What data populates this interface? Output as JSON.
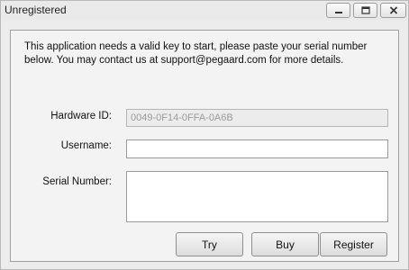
{
  "window": {
    "title": "Unregistered"
  },
  "message": "This application needs a valid key to start, please paste your serial number below. You may contact us at support@pegaard.com for more details.",
  "form": {
    "hardware_id_label": "Hardware ID:",
    "hardware_id_value": "0049-0F14-0FFA-0A6B",
    "username_label": "Username:",
    "username_value": "",
    "serial_label": "Serial Number:",
    "serial_value": ""
  },
  "buttons": {
    "try": "Try",
    "buy": "Buy",
    "register": "Register"
  }
}
